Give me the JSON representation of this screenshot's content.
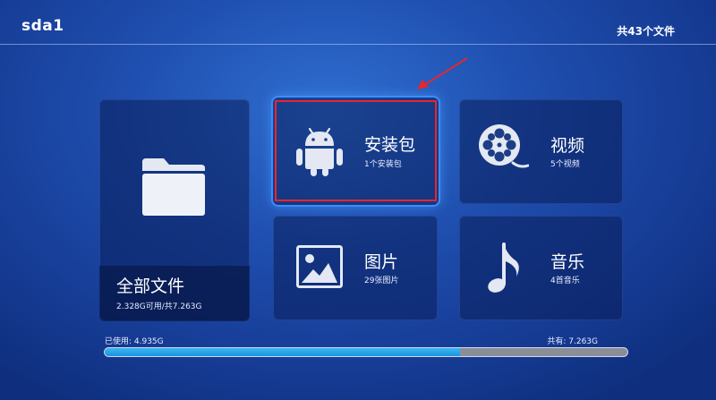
{
  "header": {
    "drive_name": "sda1",
    "file_count": "共43个文件"
  },
  "tiles": {
    "all_files": {
      "label": "全部文件",
      "sub": "2.328G可用/共7.263G",
      "icon": "folder-icon"
    },
    "apk": {
      "label": "安装包",
      "sub": "1个安装包",
      "icon": "android-icon"
    },
    "video": {
      "label": "视频",
      "sub": "5个视频",
      "icon": "film-reel-icon"
    },
    "pictures": {
      "label": "图片",
      "sub": "29张图片",
      "icon": "image-icon"
    },
    "music": {
      "label": "音乐",
      "sub": "4首音乐",
      "icon": "music-note-icon"
    }
  },
  "storage": {
    "used_label": "已使用: 4.935G",
    "total_label": "共有: 7.263G",
    "used_fraction": 0.68
  },
  "colors": {
    "background": "#1f4fb0",
    "focus_glow": "#3c8cff",
    "annotation_red": "#e8262a",
    "bar_fill": "#1a95dd",
    "bar_track": "#8a8e97"
  }
}
